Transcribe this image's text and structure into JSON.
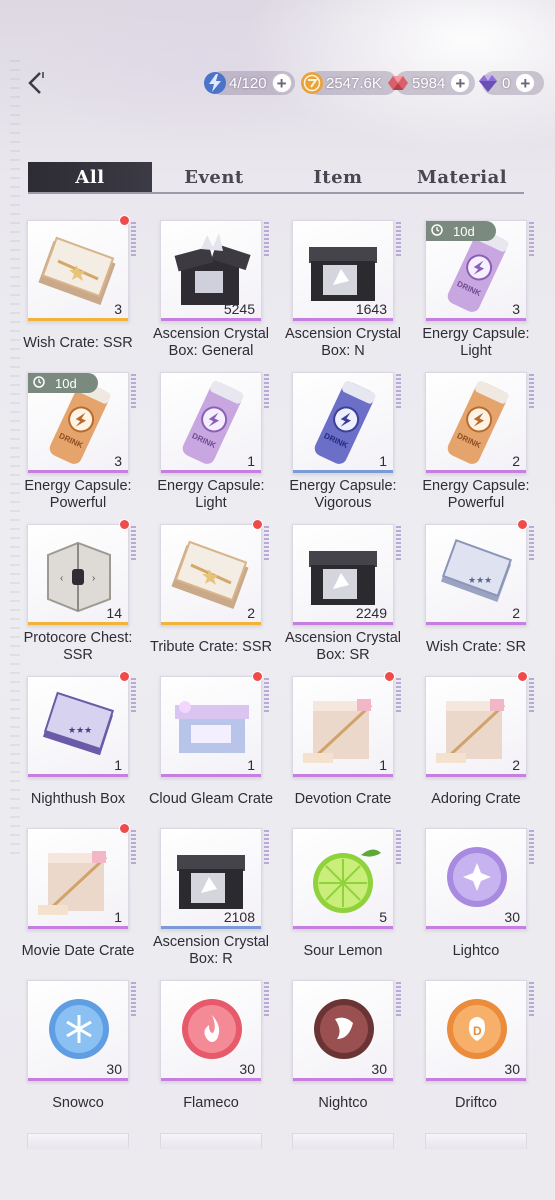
{
  "header": {
    "energy": {
      "value": "4/120",
      "icon": "energy-lightning-icon"
    },
    "gold": {
      "value": "2547.6K",
      "icon": "gold-coin-icon"
    },
    "gems": {
      "value": "5984",
      "icon": "red-gem-icon"
    },
    "crystals": {
      "value": "0",
      "icon": "purple-crystal-icon"
    }
  },
  "tabs": [
    "All",
    "Event",
    "Item",
    "Material"
  ],
  "active_tab": "All",
  "items": [
    {
      "name": "Wish Crate: SSR",
      "count": "3",
      "rarity": "gold",
      "icon": "gold-crate-icon",
      "new": true
    },
    {
      "name": "Ascension Crystal Box: General",
      "count": "5245",
      "rarity": "purple",
      "icon": "crystal-box-open-icon"
    },
    {
      "name": "Ascension Crystal Box: N",
      "count": "1643",
      "rarity": "purple",
      "icon": "crystal-box-closed-icon"
    },
    {
      "name": "Energy Capsule: Light",
      "count": "3",
      "rarity": "purple",
      "icon": "energy-can-lilac-icon",
      "timer": "10d"
    },
    {
      "name": "Energy Capsule: Powerful",
      "count": "3",
      "rarity": "purple",
      "icon": "energy-can-orange-icon",
      "timer": "10d"
    },
    {
      "name": "Energy Capsule: Light",
      "count": "1",
      "rarity": "purple",
      "icon": "energy-can-lilac-icon"
    },
    {
      "name": "Energy Capsule: Vigorous",
      "count": "1",
      "rarity": "blue",
      "icon": "energy-can-blue-icon"
    },
    {
      "name": "Energy Capsule: Powerful",
      "count": "2",
      "rarity": "purple",
      "icon": "energy-can-orange-icon"
    },
    {
      "name": "Protocore Chest: SSR",
      "count": "14",
      "rarity": "gold",
      "icon": "protocore-chest-icon",
      "new": true
    },
    {
      "name": "Tribute Crate: SSR",
      "count": "2",
      "rarity": "gold",
      "icon": "gold-crate-icon",
      "new": true
    },
    {
      "name": "Ascension Crystal Box: SR",
      "count": "2249",
      "rarity": "purple",
      "icon": "crystal-box-closed-icon"
    },
    {
      "name": "Wish Crate: SR",
      "count": "2",
      "rarity": "purple",
      "icon": "silver-crate-icon",
      "new": true
    },
    {
      "name": "Nighthush Box",
      "count": "1",
      "rarity": "purple",
      "icon": "nighthush-box-icon",
      "new": true
    },
    {
      "name": "Cloud Gleam Crate",
      "count": "1",
      "rarity": "purple",
      "icon": "cloud-gleam-crate-icon",
      "new": true
    },
    {
      "name": "Devotion Crate",
      "count": "1",
      "rarity": "purple",
      "icon": "gift-box-icon",
      "new": true
    },
    {
      "name": "Adoring Crate",
      "count": "2",
      "rarity": "purple",
      "icon": "gift-box-icon",
      "new": true
    },
    {
      "name": "Movie Date Crate",
      "count": "1",
      "rarity": "purple",
      "icon": "gift-box-icon",
      "new": true
    },
    {
      "name": "Ascension Crystal Box: R",
      "count": "2108",
      "rarity": "blue",
      "icon": "crystal-box-closed-icon"
    },
    {
      "name": "Sour Lemon",
      "count": "5",
      "rarity": "purple",
      "icon": "lime-icon"
    },
    {
      "name": "Lightco",
      "count": "30",
      "rarity": "purple",
      "icon": "lightco-coin-icon"
    },
    {
      "name": "Snowco",
      "count": "30",
      "rarity": "purple",
      "icon": "snowco-coin-icon"
    },
    {
      "name": "Flameco",
      "count": "30",
      "rarity": "purple",
      "icon": "flameco-coin-icon"
    },
    {
      "name": "Nightco",
      "count": "30",
      "rarity": "purple",
      "icon": "nightco-coin-icon"
    },
    {
      "name": "Driftco",
      "count": "30",
      "rarity": "purple",
      "icon": "driftco-coin-icon"
    }
  ]
}
